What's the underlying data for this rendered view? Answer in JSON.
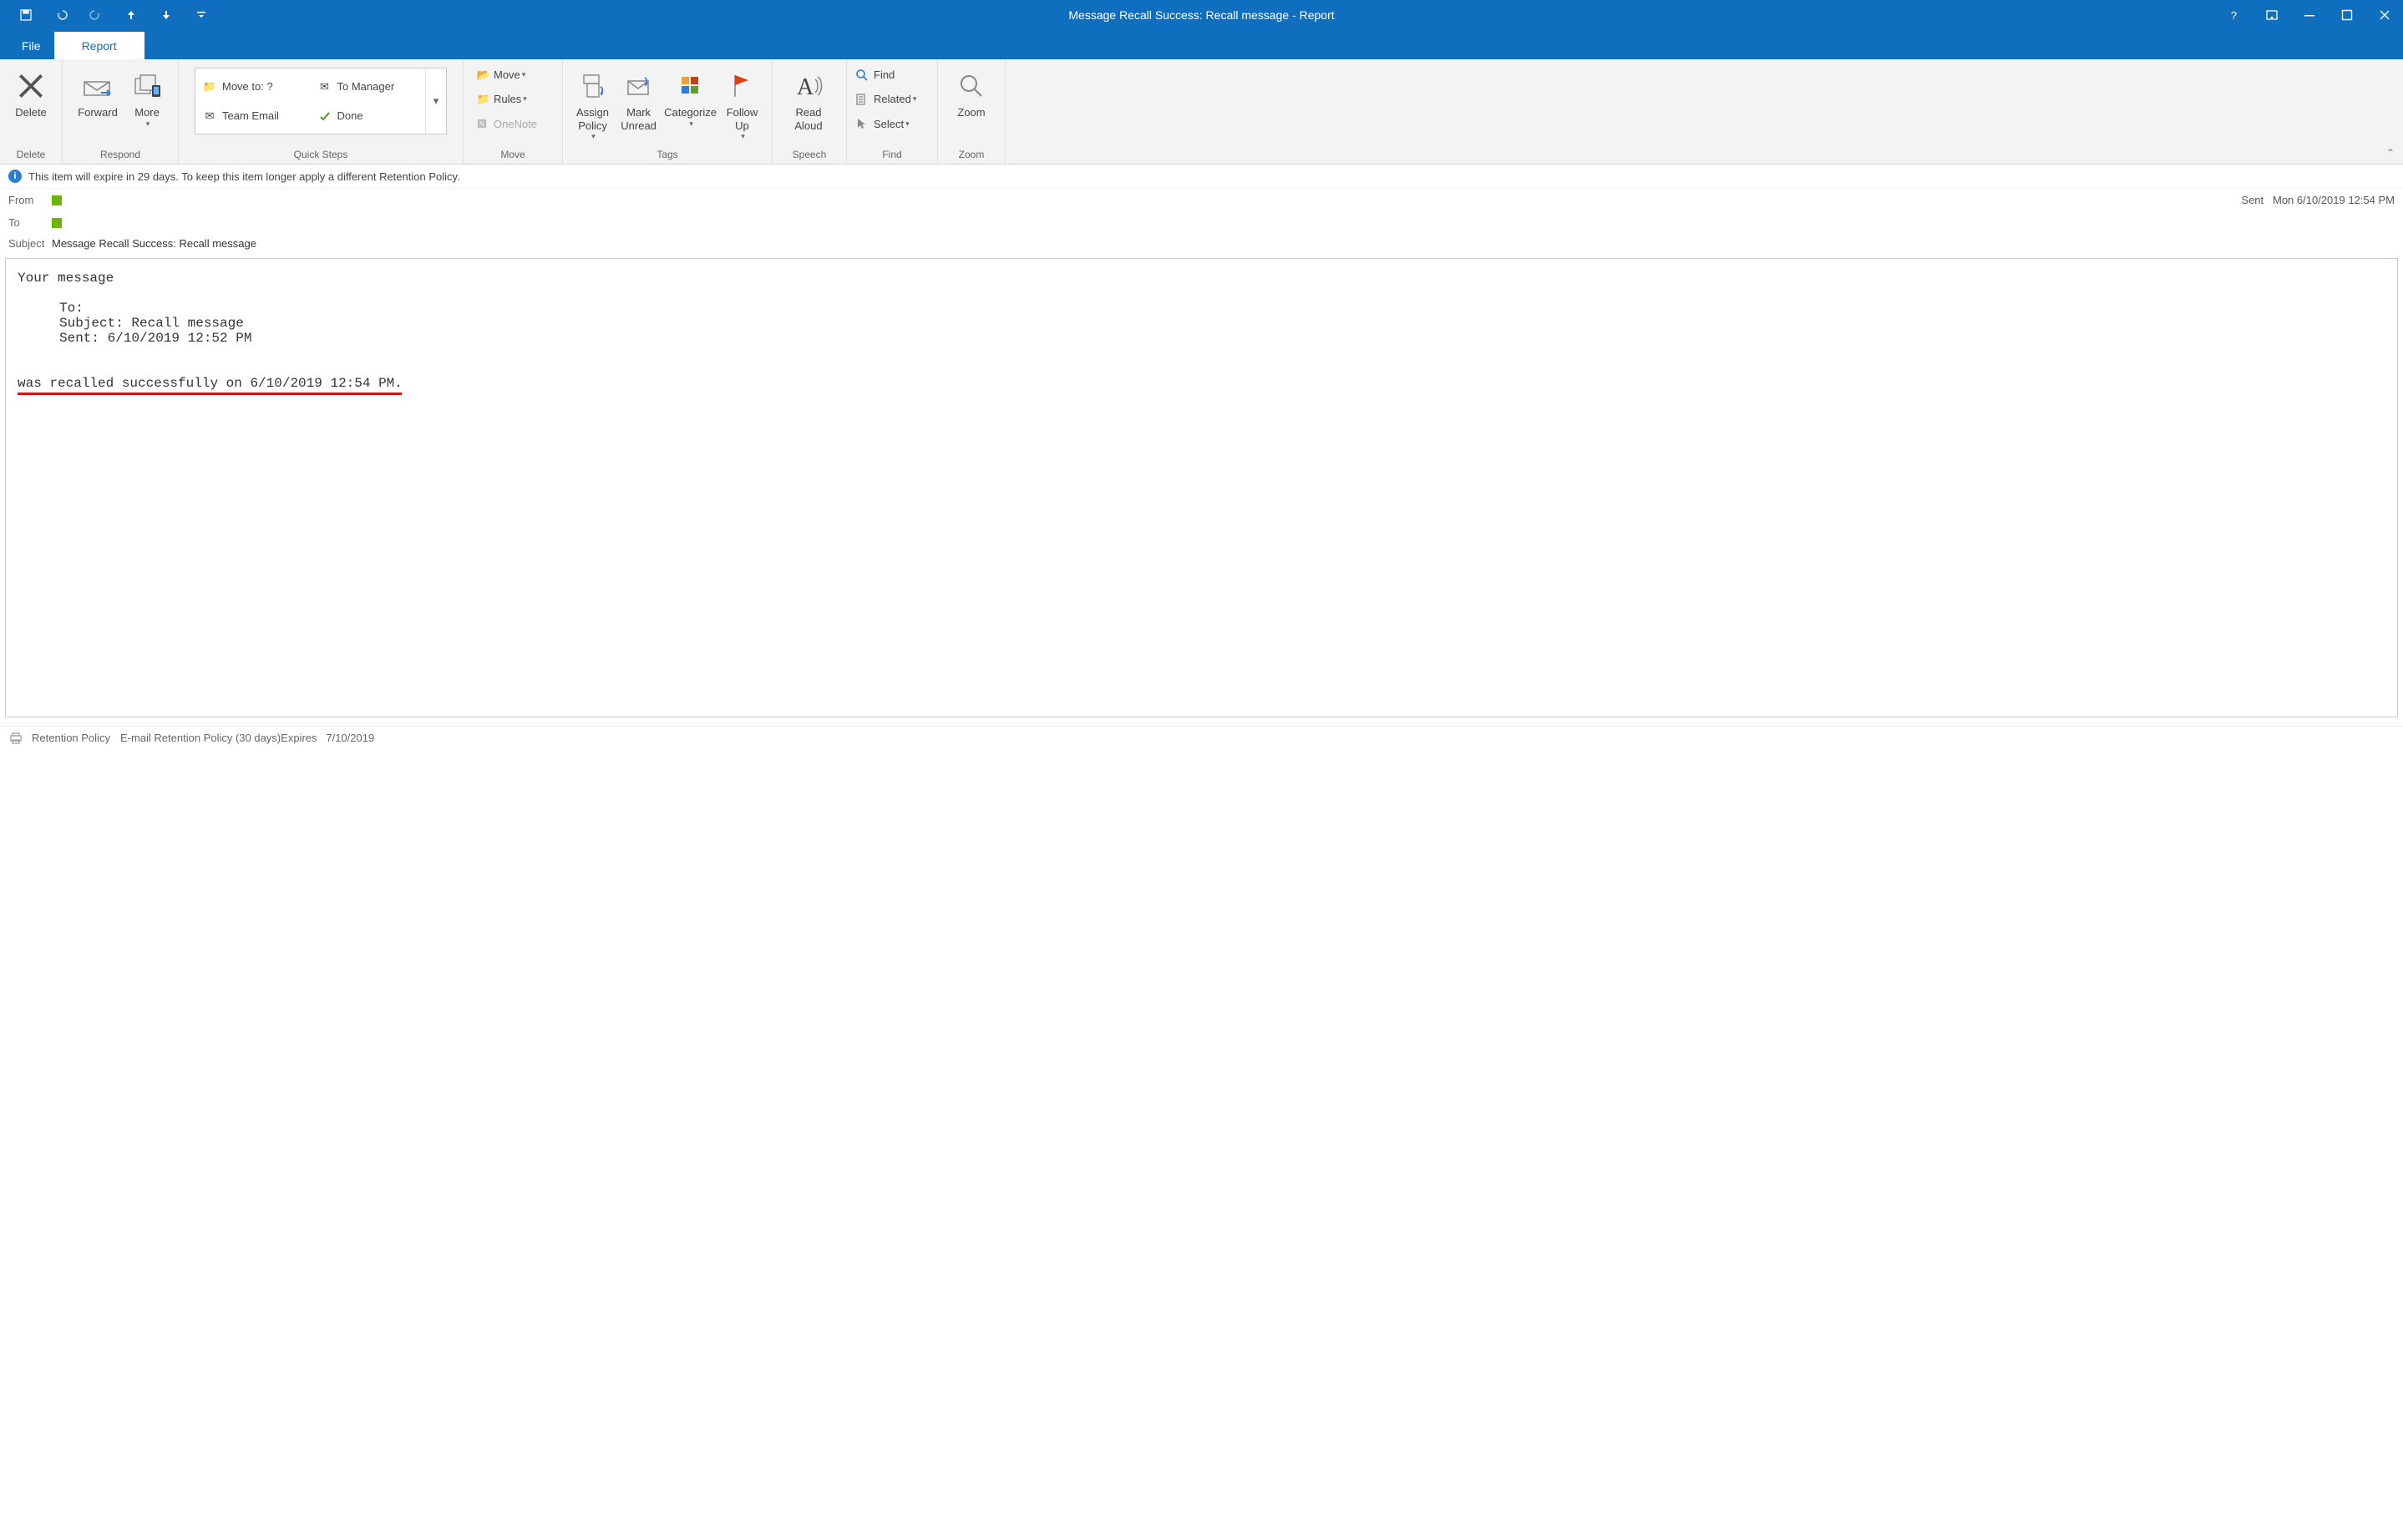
{
  "window": {
    "title": "Message Recall Success: Recall message  -  Report"
  },
  "tabs": {
    "file": "File",
    "report": "Report"
  },
  "ribbon": {
    "delete": {
      "btn": "Delete",
      "label": "Delete"
    },
    "respond": {
      "forward": "Forward",
      "more": "More",
      "label": "Respond"
    },
    "quicksteps": {
      "move_to": "Move to: ?",
      "to_manager": "To Manager",
      "team_email": "Team Email",
      "done": "Done",
      "label": "Quick Steps"
    },
    "move": {
      "move_btn": "Move",
      "rules_btn": "Rules",
      "onenote_btn": "OneNote",
      "label": "Move"
    },
    "tags": {
      "assign_policy": "Assign Policy",
      "mark_unread": "Mark Unread",
      "categorize": "Categorize",
      "follow_up": "Follow Up",
      "label": "Tags"
    },
    "speech": {
      "read_aloud": "Read Aloud",
      "label": "Speech"
    },
    "editing": {
      "find": "Find",
      "related": "Related",
      "select": "Select",
      "label": "Find"
    },
    "zoom": {
      "btn": "Zoom",
      "label": "Zoom"
    }
  },
  "infobar": {
    "text": "This item will expire in 29 days. To keep this item longer apply a different Retention Policy."
  },
  "header": {
    "from_label": "From",
    "to_label": "To",
    "subject_label": "Subject",
    "subject_value": "Message Recall Success: Recall message",
    "sent_label": "Sent",
    "sent_value": "Mon 6/10/2019 12:54 PM"
  },
  "body": {
    "l1": "Your message",
    "l2": "To:",
    "l3": "Subject:    Recall message",
    "l4": "Sent:  6/10/2019 12:52 PM",
    "l5": "was recalled successfully on 6/10/2019 12:54 PM."
  },
  "statusbar": {
    "retention_label": "Retention Policy",
    "retention_value": "E-mail Retention Policy (30 days)",
    "expires_label": "Expires",
    "expires_value": "7/10/2019"
  }
}
